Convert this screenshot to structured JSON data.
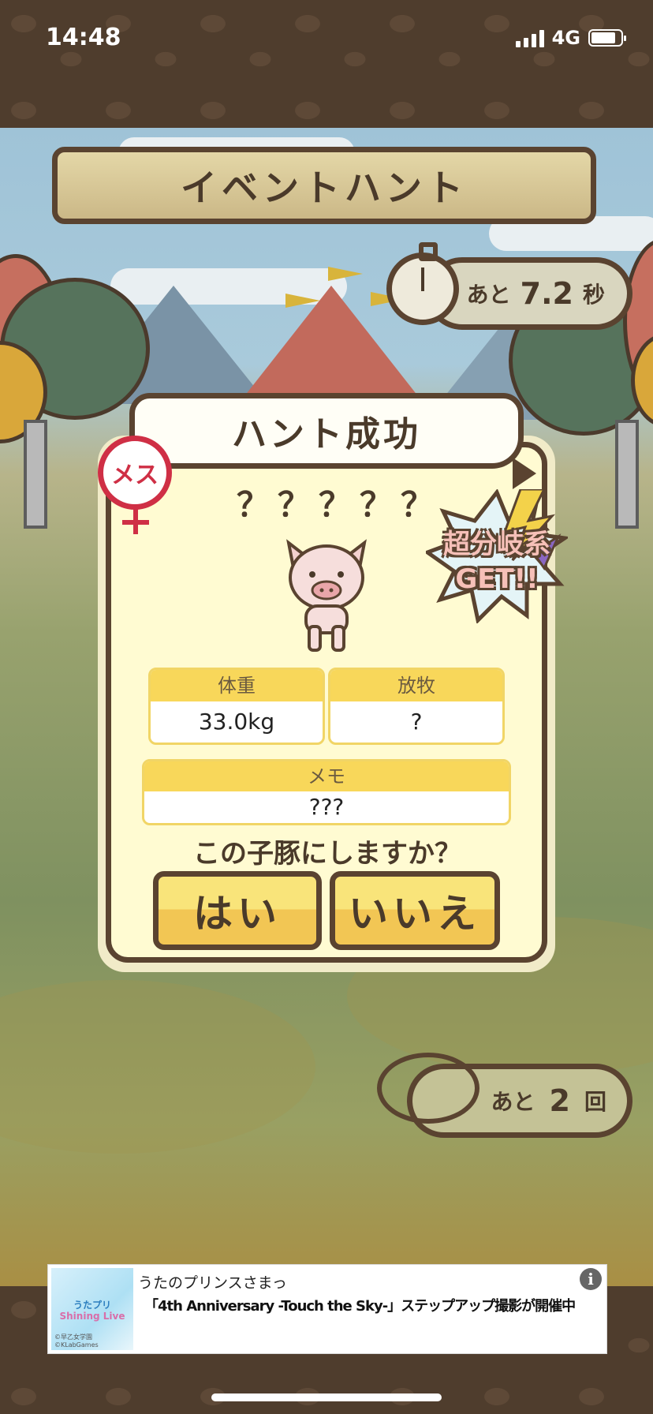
{
  "status_bar": {
    "time": "14:48",
    "network": "4G"
  },
  "game": {
    "title": "イベントハント",
    "timer": {
      "prefix": "あと",
      "value": "7.2",
      "unit": "秒"
    },
    "result": {
      "banner": "ハント成功",
      "gender_badge": "メス",
      "pig_name": "？？？？？",
      "burst_line1": "超分岐系",
      "burst_line2": "GET!!",
      "weight": {
        "label": "体重",
        "value": "33.0kg"
      },
      "grazing": {
        "label": "放牧",
        "value": "?"
      },
      "memo": {
        "label": "メモ",
        "value": "???"
      },
      "prompt": "この子豚にしますか？",
      "yes_button": "はい",
      "no_button": "いいえ"
    },
    "attempts": {
      "prefix": "あと",
      "value": "2",
      "unit": "回"
    }
  },
  "ad": {
    "image_title": "うたプリ",
    "image_subtitle": "Shining Live",
    "image_credit": "©早乙女学園 ©KLabGames",
    "title": "うたのプリンスさまっ",
    "body": "「4th Anniversary -Touch the Sky-」ステップアップ撮影が開催中",
    "info_icon": "i"
  },
  "colors": {
    "brown_border": "#5a4330",
    "card_fill": "#fffbd2",
    "button_yellow": "#f2c654",
    "female_red": "#cf2f45"
  }
}
